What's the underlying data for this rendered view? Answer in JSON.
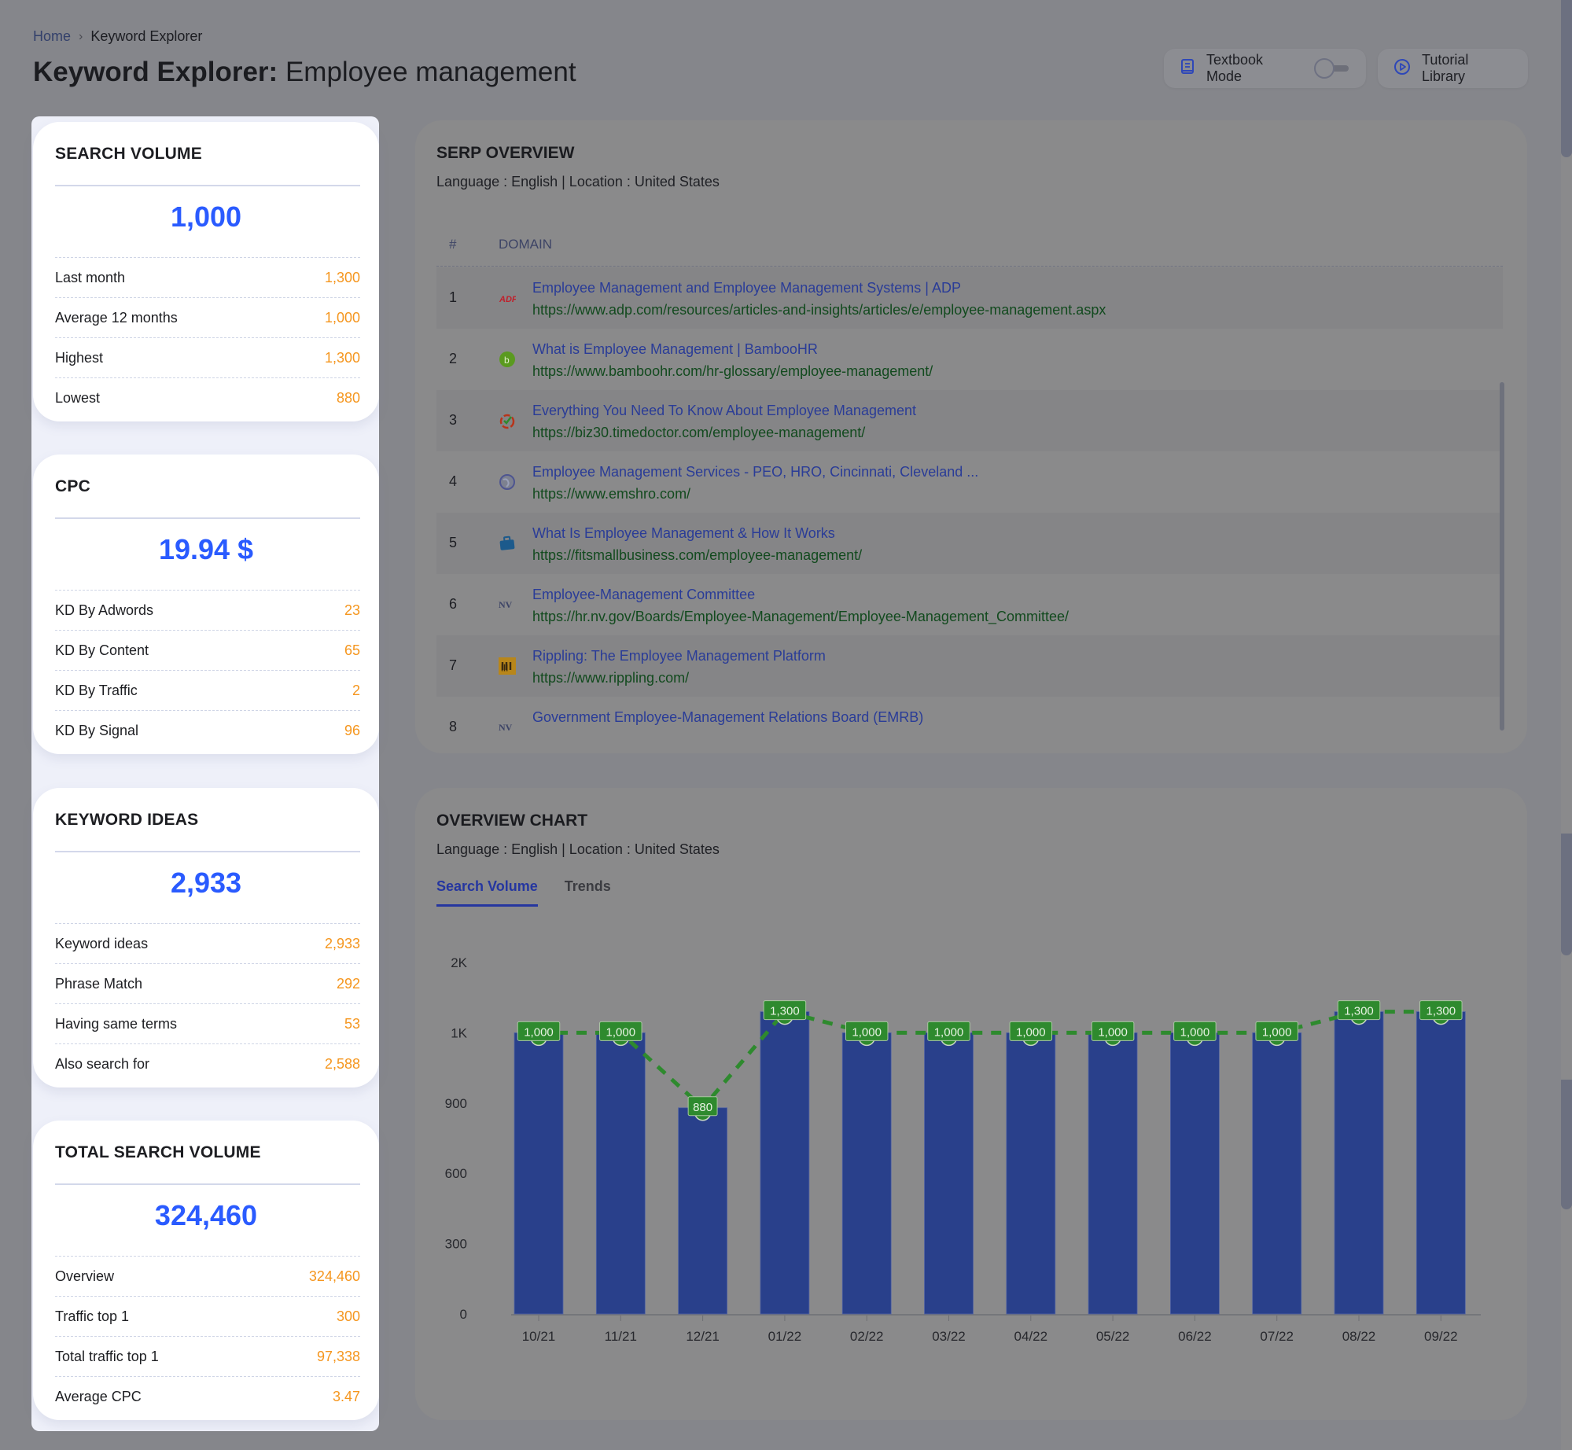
{
  "breadcrumb": {
    "home": "Home",
    "separator": "›",
    "current": "Keyword Explorer"
  },
  "page_title": {
    "prefix": "Keyword Explorer:",
    "keyword": "Employee management"
  },
  "header_buttons": {
    "textbook_mode": {
      "label": "Textbook Mode",
      "icon": "book-icon",
      "toggle_on": false
    },
    "tutorial_library": {
      "label": "Tutorial Library",
      "icon": "play-circle-icon"
    }
  },
  "cards": [
    {
      "id": "search-volume",
      "title": "SEARCH VOLUME",
      "value": "1,000",
      "rows": [
        {
          "label": "Last month",
          "value": "1,300"
        },
        {
          "label": "Average 12 months",
          "value": "1,000"
        },
        {
          "label": "Highest",
          "value": "1,300"
        },
        {
          "label": "Lowest",
          "value": "880"
        }
      ]
    },
    {
      "id": "cpc",
      "title": "CPC",
      "value": "19.94 $",
      "rows": [
        {
          "label": "KD By Adwords",
          "value": "23"
        },
        {
          "label": "KD By Content",
          "value": "65"
        },
        {
          "label": "KD By Traffic",
          "value": "2"
        },
        {
          "label": "KD By Signal",
          "value": "96"
        }
      ]
    },
    {
      "id": "keyword-ideas",
      "title": "KEYWORD IDEAS",
      "value": "2,933",
      "rows": [
        {
          "label": "Keyword ideas",
          "value": "2,933"
        },
        {
          "label": "Phrase Match",
          "value": "292"
        },
        {
          "label": "Having same terms",
          "value": "53"
        },
        {
          "label": "Also search for",
          "value": "2,588"
        }
      ]
    },
    {
      "id": "total-search-volume",
      "title": "TOTAL SEARCH VOLUME",
      "value": "324,460",
      "rows": [
        {
          "label": "Overview",
          "value": "324,460"
        },
        {
          "label": "Traffic top 1",
          "value": "300"
        },
        {
          "label": "Total traffic top 1",
          "value": "97,338"
        },
        {
          "label": "Average CPC",
          "value": "3.47"
        }
      ]
    }
  ],
  "serp": {
    "title": "SERP OVERVIEW",
    "subtitle": "Language : English | Location : United States",
    "columns": {
      "num": "#",
      "domain": "DOMAIN"
    },
    "rows": [
      {
        "num": "1",
        "icon": "adp-logo-icon",
        "title": "Employee Management and Employee Management Systems | ADP",
        "url": "https://www.adp.com/resources/articles-and-insights/articles/e/employee-management.aspx"
      },
      {
        "num": "2",
        "icon": "bamboohr-logo-icon",
        "title": "What is Employee Management | BambooHR",
        "url": "https://www.bamboohr.com/hr-glossary/employee-management/"
      },
      {
        "num": "3",
        "icon": "timedoctor-logo-icon",
        "title": "Everything You Need To Know About Employee Management",
        "url": "https://biz30.timedoctor.com/employee-management/"
      },
      {
        "num": "4",
        "icon": "globe-icon",
        "title": "Employee Management Services - PEO, HRO, Cincinnati, Cleveland ...",
        "url": "https://www.emshro.com/"
      },
      {
        "num": "5",
        "icon": "briefcase-icon",
        "title": "What Is Employee Management & How It Works",
        "url": "https://fitsmallbusiness.com/employee-management/"
      },
      {
        "num": "6",
        "icon": "nv-logo-icon",
        "title": "Employee-Management Committee",
        "url": "https://hr.nv.gov/Boards/Employee-Management/Employee-Management_Committee/"
      },
      {
        "num": "7",
        "icon": "rippling-logo-icon",
        "title": "Rippling: The Employee Management Platform",
        "url": "https://www.rippling.com/"
      },
      {
        "num": "8",
        "icon": "nv-logo-icon",
        "title": "Government Employee-Management Relations Board (EMRB)",
        "url": ""
      }
    ]
  },
  "overview_chart": {
    "title": "OVERVIEW CHART",
    "subtitle": "Language : English | Location : United States",
    "tabs": [
      {
        "label": "Search Volume",
        "active": true
      },
      {
        "label": "Trends",
        "active": false
      }
    ]
  },
  "colors": {
    "accent": "#2a5bff",
    "value_orange": "#f5961e",
    "bar": "#29408b",
    "line": "#2e8a2e",
    "label_bg": "#2e8a2e"
  },
  "chart_data": {
    "type": "bar",
    "title": "",
    "xlabel": "",
    "ylabel": "",
    "categories": [
      "10/21",
      "11/21",
      "12/21",
      "01/22",
      "02/22",
      "03/22",
      "04/22",
      "05/22",
      "06/22",
      "07/22",
      "08/22",
      "09/22"
    ],
    "series": [
      {
        "name": "Search Volume",
        "kind": "bar",
        "values": [
          1000,
          1000,
          880,
          1300,
          1000,
          1000,
          1000,
          1000,
          1000,
          1000,
          1300,
          1300
        ]
      },
      {
        "name": "Trend",
        "kind": "line-dashed",
        "values": [
          1000,
          1000,
          880,
          1300,
          1000,
          1000,
          1000,
          1000,
          1000,
          1000,
          1300,
          1300
        ]
      }
    ],
    "data_labels": [
      "1,000",
      "1,000",
      "880",
      "1,300",
      "1,000",
      "1,000",
      "1,000",
      "1,000",
      "1,000",
      "1,000",
      "1,300",
      "1,300"
    ],
    "y_ticks": [
      0,
      300,
      600,
      900,
      1000,
      2000
    ],
    "y_tick_labels": [
      "0",
      "300",
      "600",
      "900",
      "1K",
      "2K"
    ],
    "ylim": [
      0,
      2000
    ],
    "grid": false,
    "legend": "none"
  }
}
